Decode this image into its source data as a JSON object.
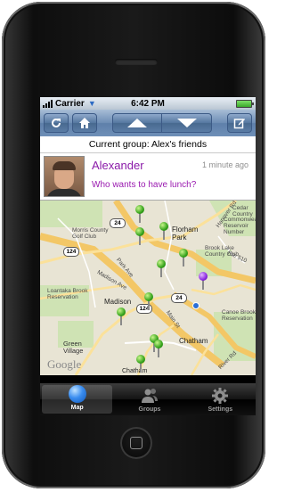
{
  "status_bar": {
    "carrier": "Carrier",
    "time": "6:42 PM"
  },
  "toolbar": {
    "refresh_icon": "refresh-icon",
    "home_icon": "home-icon",
    "up_icon": "arrow-up-icon",
    "down_icon": "arrow-down-icon",
    "compose_icon": "compose-icon"
  },
  "group_header": {
    "text": "Current group: Alex's friends"
  },
  "post": {
    "name": "Alexander",
    "timestamp": "1 minute ago",
    "message": "Who wants to have lunch?"
  },
  "map": {
    "labels": {
      "morris_county": "Morris County\nGolf Club",
      "florham_park": "Florham\nPark",
      "brook_lake": "Brook Lake\nCountry Club",
      "loantaka": "Loantaka Brook\nReservation",
      "madison": "Madison",
      "green_village": "Green\nVillage",
      "chatham": "Chatham",
      "chatham2": "Chatham",
      "canoe_brook": "Canoe Brook\nReservation",
      "cedar": "Cedar\nCountry",
      "commonwealth": "Commonweal\nReservoir\nNumber",
      "main_st": "Main St",
      "madison_ave": "Madison Ave",
      "park_ave": "Park Ave",
      "rte_510": "Rte 510",
      "river_rd": "River Rd",
      "hanover_rd": "Hanover Rd",
      "google": "Google"
    },
    "shields": [
      "24",
      "124",
      "124",
      "24"
    ],
    "pin_colors": {
      "default": "#35a31c",
      "selected": "#8a2ae0"
    }
  },
  "tabs": [
    {
      "label": "Map",
      "icon": "globe-icon",
      "active": true
    },
    {
      "label": "Groups",
      "icon": "people-icon",
      "active": false
    },
    {
      "label": "Settings",
      "icon": "gear-icon",
      "active": false
    }
  ]
}
